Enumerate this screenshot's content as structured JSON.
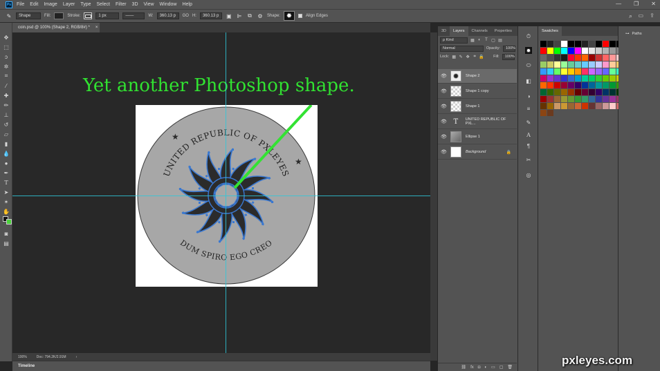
{
  "app": {
    "logo": "Ps"
  },
  "menu": [
    "File",
    "Edit",
    "Image",
    "Layer",
    "Type",
    "Select",
    "Filter",
    "3D",
    "View",
    "Window",
    "Help"
  ],
  "window_controls": [
    "—",
    "❐",
    "✕"
  ],
  "options_bar": {
    "mode": "Shape",
    "fill_label": "Fill:",
    "stroke_label": "Stroke:",
    "stroke_width": "1 px",
    "w_label": "W:",
    "w_value": "360.13 p",
    "link": "GO",
    "h_label": "H:",
    "h_value": "360.13 p",
    "shape_label": "Shape:",
    "align_edges": "Align Edges"
  },
  "document_tab": {
    "title": "coin.psd @ 100% (Shape 2, RGB/8#) *",
    "close": "×"
  },
  "canvas": {
    "caption": "Yet another Photoshop shape.",
    "coin_top_text": "UNITED REPUBLIC OF PXLEYES",
    "coin_bottom_text": "DUM SPIRO EGO CREO",
    "star": "★"
  },
  "status_bar": {
    "zoom": "100%",
    "doc": "Doc: 794.2K/2.91M",
    "arrow": "›"
  },
  "timeline_label": "Timeline",
  "layers_panel": {
    "tabs": [
      "3D",
      "Layers",
      "Channels",
      "Properties"
    ],
    "active_tab": "Layers",
    "filter": "ρ Kind",
    "blend_mode": "Normal",
    "opacity_label": "Opacity:",
    "opacity_value": "100%",
    "lock_label": "Lock:",
    "fill_label": "Fill:",
    "fill_value": "100%",
    "layers": [
      {
        "name": "Shape 2",
        "thumb": "sun",
        "selected": true
      },
      {
        "name": "Shape 1 copy",
        "thumb": "checker",
        "selected": false
      },
      {
        "name": "Shape 1",
        "thumb": "checker",
        "selected": false
      },
      {
        "name": "UNITED REPUBLIC OF PXL...",
        "thumb": "text",
        "selected": false
      },
      {
        "name": "Ellipse 1",
        "thumb": "ellipse",
        "selected": false
      },
      {
        "name": "Background",
        "thumb": "white",
        "selected": false,
        "italic": true,
        "locked": true
      }
    ],
    "footer_icons": [
      "link-icon",
      "fx-icon",
      "mask-icon",
      "adjustment-icon",
      "group-icon",
      "new-layer-icon",
      "trash-icon"
    ]
  },
  "swatches_panel": {
    "title": "Swatches",
    "colors": [
      "#000000",
      "#222222",
      "#444444",
      "#ffffff",
      "#000000",
      "#000000",
      "#222222",
      "#444444",
      "#000000",
      "#ff0000",
      "#000000",
      "#000000",
      "#ff0000",
      "#ffff00",
      "#00ff00",
      "#00ffff",
      "#0000ff",
      "#ff00ff",
      "#ffffff",
      "#e6e6e6",
      "#cccccc",
      "#b3b3b3",
      "#999999",
      "#808080",
      "#666666",
      "#4d4d4d",
      "#333333",
      "#1a1a1a",
      "#ff0033",
      "#ff3300",
      "#ff6600",
      "#990000",
      "#cc3333",
      "#ff6666",
      "#ff9999",
      "#ffcccc",
      "#99cc66",
      "#cccc66",
      "#ffff99",
      "#99ff99",
      "#66cc99",
      "#66cccc",
      "#66ccff",
      "#99ccff",
      "#ccccff",
      "#ff99cc",
      "#ffcc99",
      "#ffcc66",
      "#3399ff",
      "#33ccff",
      "#66ff66",
      "#ffff33",
      "#ffcc00",
      "#ff9900",
      "#ff3366",
      "#cc66ff",
      "#9966ff",
      "#6666ff",
      "#66ff99",
      "#33ffcc",
      "#cc0066",
      "#9933cc",
      "#6633cc",
      "#3333cc",
      "#3366cc",
      "#0099cc",
      "#00cc99",
      "#00cc66",
      "#33cc33",
      "#66cc00",
      "#99cc00",
      "#cccc00",
      "#ff6600",
      "#ff3300",
      "#cc0000",
      "#990033",
      "#660066",
      "#330066",
      "#003399",
      "#006699",
      "#009999",
      "#009966",
      "#009933",
      "#339900",
      "#006633",
      "#336600",
      "#666600",
      "#996600",
      "#993300",
      "#660000",
      "#660033",
      "#330033",
      "#330066",
      "#003366",
      "#003333",
      "#003300",
      "#990000",
      "#993333",
      "#996633",
      "#999933",
      "#669933",
      "#339933",
      "#339966",
      "#336699",
      "#333399",
      "#663399",
      "#993399",
      "#993366",
      "#663300",
      "#996600",
      "#cc9966",
      "#cc9933",
      "#996633",
      "#cc6633",
      "#cc3300",
      "#663333",
      "#996666",
      "#cc9999",
      "#ffcccc",
      "#cc6666",
      "#8b4513",
      "#6b3a1e"
    ]
  },
  "paths_panel": {
    "title": "Paths"
  },
  "watermark": "pxleyes.com"
}
